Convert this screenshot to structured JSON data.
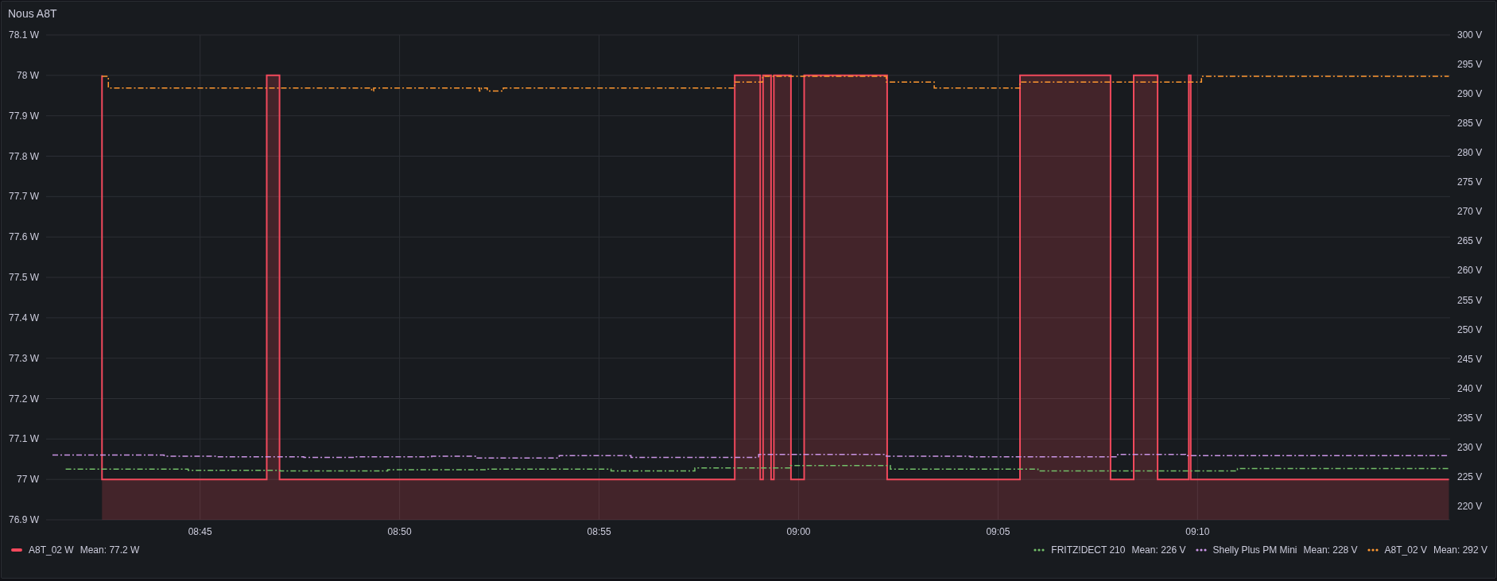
{
  "panel": {
    "title": "Nous A8T"
  },
  "chart_data": {
    "type": "line",
    "grid": true,
    "xlim": [
      521.14,
      556.33
    ],
    "ylim": [
      76.9,
      78.1
    ],
    "y2lim": [
      217.7,
      300
    ],
    "xticks": [
      {
        "value": 525,
        "label": "08:45"
      },
      {
        "value": 530,
        "label": "08:50"
      },
      {
        "value": 535,
        "label": "08:55"
      },
      {
        "value": 540,
        "label": "09:00"
      },
      {
        "value": 545,
        "label": "09:05"
      },
      {
        "value": 550,
        "label": "09:10"
      }
    ],
    "yticks": [
      {
        "value": 76.9,
        "label": "76.9 W"
      },
      {
        "value": 77,
        "label": "77 W"
      },
      {
        "value": 77.1,
        "label": "77.1 W"
      },
      {
        "value": 77.2,
        "label": "77.2 W"
      },
      {
        "value": 77.3,
        "label": "77.3 W"
      },
      {
        "value": 77.4,
        "label": "77.4 W"
      },
      {
        "value": 77.5,
        "label": "77.5 W"
      },
      {
        "value": 77.6,
        "label": "77.6 W"
      },
      {
        "value": 77.7,
        "label": "77.7 W"
      },
      {
        "value": 77.8,
        "label": "77.8 W"
      },
      {
        "value": 77.9,
        "label": "77.9 W"
      },
      {
        "value": 78,
        "label": "78 W"
      },
      {
        "value": 78.1,
        "label": "78.1 W"
      }
    ],
    "y2ticks": [
      {
        "value": 220,
        "label": "220 V"
      },
      {
        "value": 225,
        "label": "225 V"
      },
      {
        "value": 230,
        "label": "230 V"
      },
      {
        "value": 235,
        "label": "235 V"
      },
      {
        "value": 240,
        "label": "240 V"
      },
      {
        "value": 245,
        "label": "245 V"
      },
      {
        "value": 250,
        "label": "250 V"
      },
      {
        "value": 255,
        "label": "255 V"
      },
      {
        "value": 260,
        "label": "260 V"
      },
      {
        "value": 265,
        "label": "265 V"
      },
      {
        "value": 270,
        "label": "270 V"
      },
      {
        "value": 275,
        "label": "275 V"
      },
      {
        "value": 280,
        "label": "280 V"
      },
      {
        "value": 285,
        "label": "285 V"
      },
      {
        "value": 290,
        "label": "290 V"
      },
      {
        "value": 295,
        "label": "295 V"
      },
      {
        "value": 300,
        "label": "300 V"
      }
    ],
    "series": [
      {
        "name": "A8T_02 W",
        "color": "#f2495c",
        "type": "area",
        "line_style": "solid",
        "x": [
          522.54,
          522.54,
          526.67,
          526.67,
          526.99,
          526.99,
          538.4,
          538.4,
          539.04,
          539.04,
          539.11,
          539.11,
          539.31,
          539.31,
          539.38,
          539.38,
          539.81,
          539.81,
          540.14,
          540.14,
          542.22,
          542.22,
          545.55,
          545.55,
          547.82,
          547.82,
          548.4,
          548.4,
          549.0,
          549.0,
          549.78,
          549.78,
          549.83,
          549.83,
          556.3
        ],
        "values": [
          78,
          77,
          77,
          78,
          78,
          77,
          77,
          78,
          78,
          77,
          77,
          78,
          78,
          77,
          77,
          78,
          78,
          77,
          77,
          78,
          78,
          77,
          77,
          78,
          78,
          77,
          77,
          78,
          78,
          77,
          77,
          78,
          78,
          77,
          77
        ]
      },
      {
        "name": "FRITZ!DECT 210",
        "color": "#73bf69",
        "axis": "y2",
        "line_style": "dashdot",
        "x": [
          521.63,
          524.7,
          524.7,
          527.0,
          527.0,
          529.7,
          529.7,
          532.2,
          532.2,
          535.3,
          535.3,
          537.4,
          537.4,
          539.8,
          539.8,
          542.3,
          542.3,
          546.0,
          546.0,
          551.0,
          551.0,
          556.3
        ],
        "values": [
          226.3,
          226.3,
          226.1,
          226.1,
          226.0,
          226.0,
          226.2,
          226.2,
          226.3,
          226.3,
          226.0,
          226.0,
          226.5,
          226.5,
          226.9,
          226.9,
          226.3,
          226.3,
          226.0,
          226.0,
          226.4,
          226.4
        ]
      },
      {
        "name": "Shelly Plus PM Mini",
        "color": "#ca95e5",
        "axis": "y2",
        "line_style": "dashdot",
        "x": [
          521.3,
          524.1,
          524.1,
          525.4,
          525.4,
          527.6,
          527.6,
          528.9,
          528.9,
          530.8,
          530.8,
          531.9,
          531.9,
          534.0,
          534.0,
          535.8,
          535.8,
          539.0,
          539.0,
          542.2,
          542.2,
          544.3,
          544.3,
          548.0,
          548.0,
          549.7,
          549.7,
          556.3
        ],
        "values": [
          228.7,
          228.7,
          228.5,
          228.5,
          228.4,
          228.4,
          228.3,
          228.3,
          228.4,
          228.4,
          228.5,
          228.5,
          228.2,
          228.2,
          228.6,
          228.6,
          228.3,
          228.3,
          228.8,
          228.8,
          228.5,
          228.5,
          228.4,
          228.4,
          228.8,
          228.8,
          228.6,
          228.6
        ]
      },
      {
        "name": "A8T_02 V",
        "color": "#ff9830",
        "axis": "y2",
        "line_style": "dashdot",
        "x": [
          522.54,
          522.7,
          522.7,
          529.3,
          529.3,
          529.35,
          529.35,
          532.0,
          532.0,
          532.05,
          532.05,
          532.2,
          532.2,
          532.6,
          532.6,
          538.4,
          538.4,
          539.1,
          539.1,
          542.2,
          542.2,
          543.4,
          543.4,
          545.55,
          545.55,
          550.1,
          550.1,
          556.3
        ],
        "values": [
          293,
          293,
          291,
          291,
          290.5,
          290.5,
          291,
          291,
          290.5,
          290.5,
          291,
          291,
          290.5,
          290.5,
          291,
          291,
          292,
          292,
          293,
          293,
          292,
          292,
          291,
          291,
          292,
          292,
          293,
          293
        ]
      }
    ]
  },
  "legend": {
    "left": [
      {
        "mean": "Mean: 77.2 W"
      }
    ],
    "right": [
      {
        "mean": "Mean: 226 V"
      },
      {
        "mean": "Mean: 228 V"
      },
      {
        "mean": "Mean: 292 V"
      }
    ]
  }
}
